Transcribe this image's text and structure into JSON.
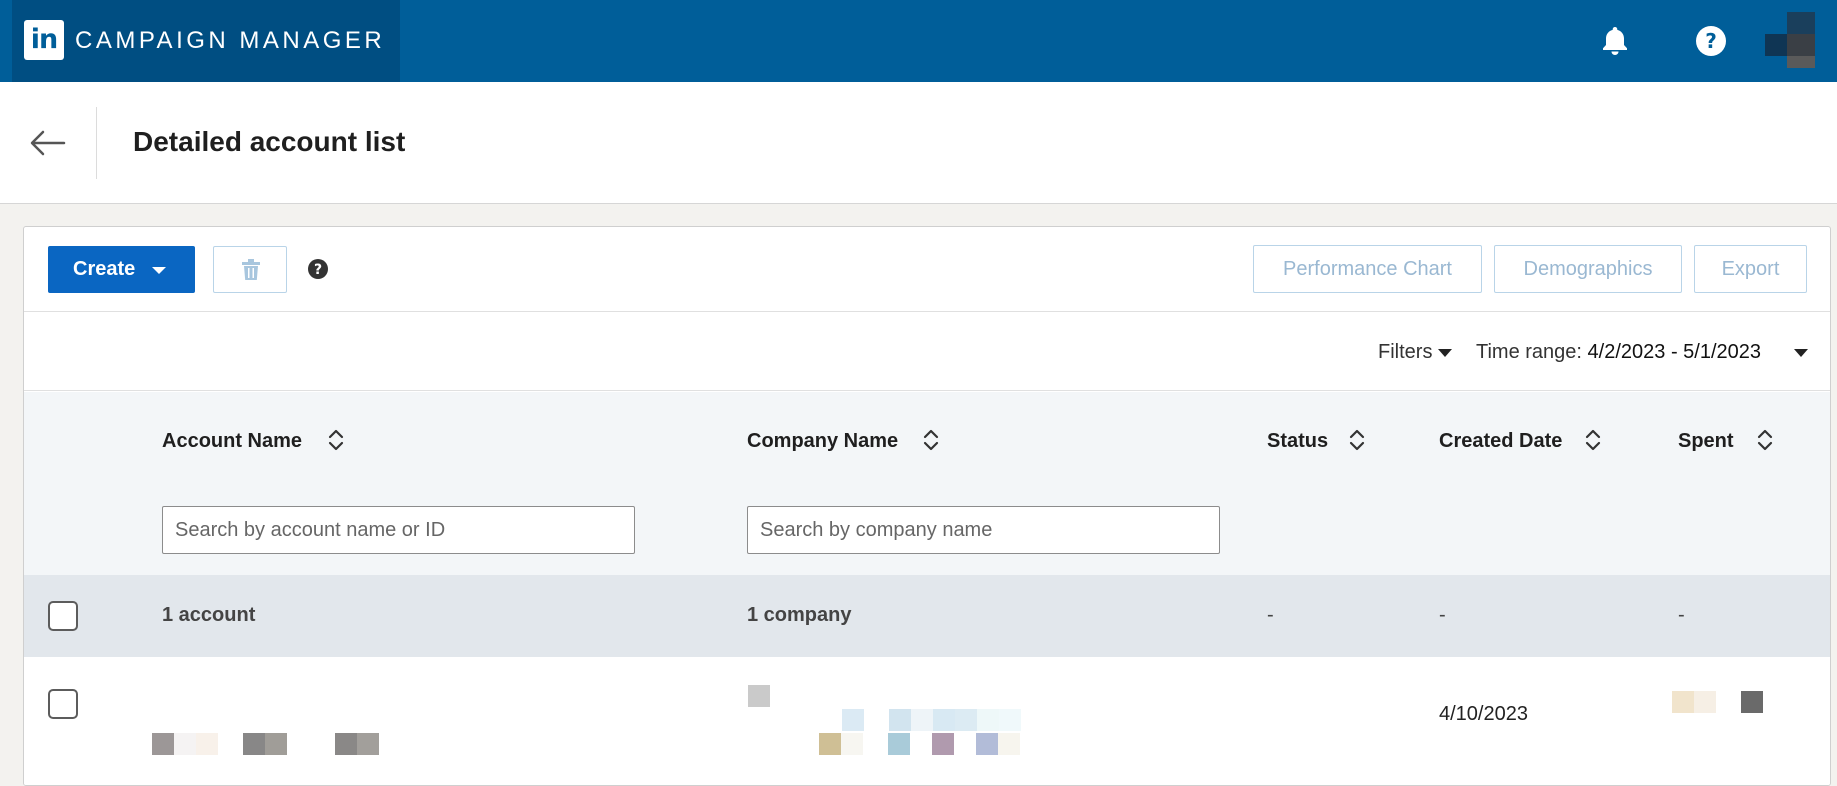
{
  "app": {
    "brand": "CAMPAIGN MANAGER",
    "logo_text": "in",
    "colors": {
      "topbar": "#005e99",
      "primary": "#0a66c2"
    }
  },
  "header": {
    "title": "Detailed account list"
  },
  "toolbar": {
    "create_label": "Create",
    "performance_chart_label": "Performance Chart",
    "demographics_label": "Demographics",
    "export_label": "Export"
  },
  "filters": {
    "filters_label": "Filters",
    "time_range_label": "Time range:",
    "time_range_value": "4/2/2023 - 5/1/2023"
  },
  "table": {
    "columns": [
      {
        "label": "Account Name"
      },
      {
        "label": "Company Name"
      },
      {
        "label": "Status"
      },
      {
        "label": "Created Date"
      },
      {
        "label": "Spent"
      }
    ],
    "search": {
      "account_placeholder": "Search by account name or ID",
      "company_placeholder": "Search by company name"
    },
    "summary": {
      "account": "1 account",
      "company": "1 company",
      "status": "-",
      "created": "-",
      "spent": "-"
    },
    "rows": [
      {
        "created_date": "4/10/2023"
      }
    ]
  }
}
